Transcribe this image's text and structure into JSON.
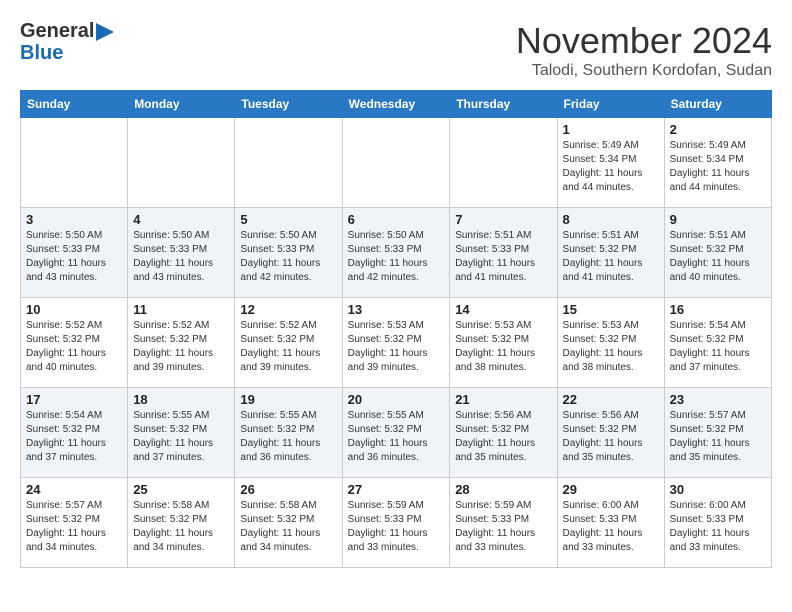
{
  "logo": {
    "line1": "General",
    "line2": "Blue"
  },
  "header": {
    "month": "November 2024",
    "location": "Talodi, Southern Kordofan, Sudan"
  },
  "weekdays": [
    "Sunday",
    "Monday",
    "Tuesday",
    "Wednesday",
    "Thursday",
    "Friday",
    "Saturday"
  ],
  "weeks": [
    [
      {
        "day": "",
        "info": ""
      },
      {
        "day": "",
        "info": ""
      },
      {
        "day": "",
        "info": ""
      },
      {
        "day": "",
        "info": ""
      },
      {
        "day": "",
        "info": ""
      },
      {
        "day": "1",
        "info": "Sunrise: 5:49 AM\nSunset: 5:34 PM\nDaylight: 11 hours and 44 minutes."
      },
      {
        "day": "2",
        "info": "Sunrise: 5:49 AM\nSunset: 5:34 PM\nDaylight: 11 hours and 44 minutes."
      }
    ],
    [
      {
        "day": "3",
        "info": "Sunrise: 5:50 AM\nSunset: 5:33 PM\nDaylight: 11 hours and 43 minutes."
      },
      {
        "day": "4",
        "info": "Sunrise: 5:50 AM\nSunset: 5:33 PM\nDaylight: 11 hours and 43 minutes."
      },
      {
        "day": "5",
        "info": "Sunrise: 5:50 AM\nSunset: 5:33 PM\nDaylight: 11 hours and 42 minutes."
      },
      {
        "day": "6",
        "info": "Sunrise: 5:50 AM\nSunset: 5:33 PM\nDaylight: 11 hours and 42 minutes."
      },
      {
        "day": "7",
        "info": "Sunrise: 5:51 AM\nSunset: 5:33 PM\nDaylight: 11 hours and 41 minutes."
      },
      {
        "day": "8",
        "info": "Sunrise: 5:51 AM\nSunset: 5:32 PM\nDaylight: 11 hours and 41 minutes."
      },
      {
        "day": "9",
        "info": "Sunrise: 5:51 AM\nSunset: 5:32 PM\nDaylight: 11 hours and 40 minutes."
      }
    ],
    [
      {
        "day": "10",
        "info": "Sunrise: 5:52 AM\nSunset: 5:32 PM\nDaylight: 11 hours and 40 minutes."
      },
      {
        "day": "11",
        "info": "Sunrise: 5:52 AM\nSunset: 5:32 PM\nDaylight: 11 hours and 39 minutes."
      },
      {
        "day": "12",
        "info": "Sunrise: 5:52 AM\nSunset: 5:32 PM\nDaylight: 11 hours and 39 minutes."
      },
      {
        "day": "13",
        "info": "Sunrise: 5:53 AM\nSunset: 5:32 PM\nDaylight: 11 hours and 39 minutes."
      },
      {
        "day": "14",
        "info": "Sunrise: 5:53 AM\nSunset: 5:32 PM\nDaylight: 11 hours and 38 minutes."
      },
      {
        "day": "15",
        "info": "Sunrise: 5:53 AM\nSunset: 5:32 PM\nDaylight: 11 hours and 38 minutes."
      },
      {
        "day": "16",
        "info": "Sunrise: 5:54 AM\nSunset: 5:32 PM\nDaylight: 11 hours and 37 minutes."
      }
    ],
    [
      {
        "day": "17",
        "info": "Sunrise: 5:54 AM\nSunset: 5:32 PM\nDaylight: 11 hours and 37 minutes."
      },
      {
        "day": "18",
        "info": "Sunrise: 5:55 AM\nSunset: 5:32 PM\nDaylight: 11 hours and 37 minutes."
      },
      {
        "day": "19",
        "info": "Sunrise: 5:55 AM\nSunset: 5:32 PM\nDaylight: 11 hours and 36 minutes."
      },
      {
        "day": "20",
        "info": "Sunrise: 5:55 AM\nSunset: 5:32 PM\nDaylight: 11 hours and 36 minutes."
      },
      {
        "day": "21",
        "info": "Sunrise: 5:56 AM\nSunset: 5:32 PM\nDaylight: 11 hours and 35 minutes."
      },
      {
        "day": "22",
        "info": "Sunrise: 5:56 AM\nSunset: 5:32 PM\nDaylight: 11 hours and 35 minutes."
      },
      {
        "day": "23",
        "info": "Sunrise: 5:57 AM\nSunset: 5:32 PM\nDaylight: 11 hours and 35 minutes."
      }
    ],
    [
      {
        "day": "24",
        "info": "Sunrise: 5:57 AM\nSunset: 5:32 PM\nDaylight: 11 hours and 34 minutes."
      },
      {
        "day": "25",
        "info": "Sunrise: 5:58 AM\nSunset: 5:32 PM\nDaylight: 11 hours and 34 minutes."
      },
      {
        "day": "26",
        "info": "Sunrise: 5:58 AM\nSunset: 5:32 PM\nDaylight: 11 hours and 34 minutes."
      },
      {
        "day": "27",
        "info": "Sunrise: 5:59 AM\nSunset: 5:33 PM\nDaylight: 11 hours and 33 minutes."
      },
      {
        "day": "28",
        "info": "Sunrise: 5:59 AM\nSunset: 5:33 PM\nDaylight: 11 hours and 33 minutes."
      },
      {
        "day": "29",
        "info": "Sunrise: 6:00 AM\nSunset: 5:33 PM\nDaylight: 11 hours and 33 minutes."
      },
      {
        "day": "30",
        "info": "Sunrise: 6:00 AM\nSunset: 5:33 PM\nDaylight: 11 hours and 33 minutes."
      }
    ]
  ]
}
